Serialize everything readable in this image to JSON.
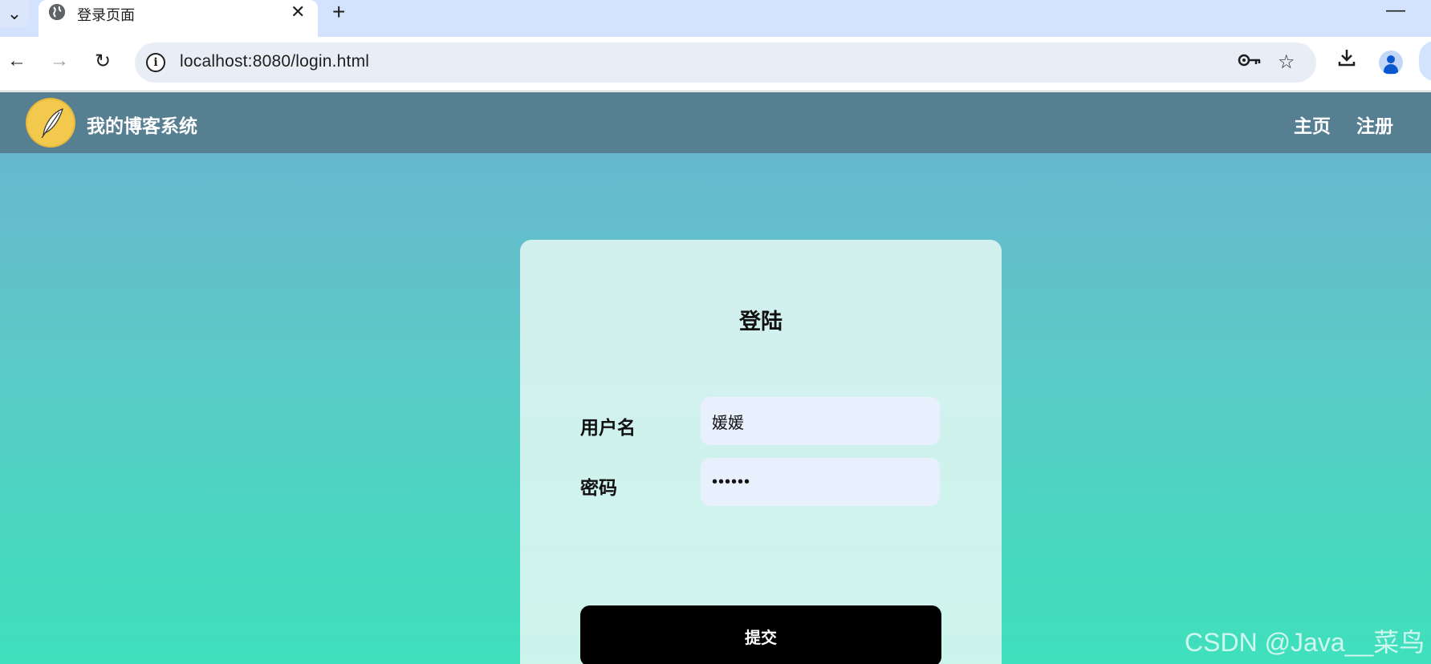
{
  "browser": {
    "tab_title": "登录页面",
    "tab_close": "✕",
    "new_tab": "+",
    "minimize": "—",
    "tab_menu": "⌄",
    "back": "←",
    "forward": "→",
    "reload": "↻",
    "url": "localhost:8080/login.html",
    "icons": {
      "info": "i",
      "key": "⚿",
      "star": "☆",
      "download": "⤓"
    }
  },
  "navbar": {
    "site_title": "我的博客系统",
    "links": [
      "主页",
      "注册"
    ]
  },
  "login": {
    "title": "登陆",
    "username_label": "用户名",
    "username_value": "媛媛",
    "password_label": "密码",
    "password_value": "••••••",
    "submit_label": "提交"
  },
  "watermark": "CSDN @Java__菜鸟",
  "colors": {
    "navbar_bg": "#577f92",
    "logo_bg": "#f2c94c",
    "button_bg": "#000000",
    "input_bg": "#e8f0fe"
  }
}
